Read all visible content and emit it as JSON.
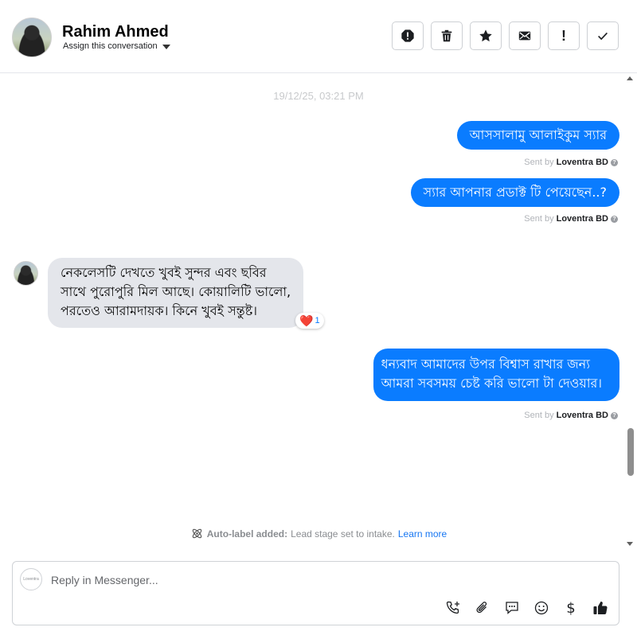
{
  "header": {
    "contact_name": "Rahim Ahmed",
    "assign_label": "Assign this conversation",
    "toolbar": [
      "spam-icon",
      "trash-icon",
      "star-icon",
      "envelope-icon",
      "exclamation-icon",
      "checkmark-icon"
    ],
    "toolbar_exclaim": "!"
  },
  "thread": {
    "timestamp": "19/12/25, 03:21 PM",
    "messages": [
      {
        "direction": "outgoing",
        "text": "আসসালামু আলাইকুম স্যার",
        "sent_prefix": "Sent by",
        "sent_by": "Loventra BD"
      },
      {
        "direction": "outgoing",
        "text": "স্যার আপনার প্রডাক্ট টি পেয়েছেন..?",
        "sent_prefix": "Sent by",
        "sent_by": "Loventra BD"
      },
      {
        "direction": "incoming",
        "lines": [
          "নেকলেসটি দেখতে খুবই সুন্দর এবং ছবির",
          "সাথে পুরোপুরি মিল আছে। কোয়ালিটি ভালো,",
          "পরতেও আরামদায়ক। কিনে খুবই সন্তুষ্ট।"
        ],
        "reaction": "❤️",
        "reaction_count": "1"
      },
      {
        "direction": "outgoing",
        "lines": [
          "ধন্যবাদ আমাদের উপর বিশ্বাস রাখার জন্য",
          "আমরা সবসময় চেষ্ট করি ভালো টা দেওয়ার।"
        ],
        "sent_prefix": "Sent by",
        "sent_by": "Loventra BD"
      }
    ],
    "auto_label": {
      "bold": "Auto-label added:",
      "text": "Lead stage set to intake.",
      "link": "Learn more"
    }
  },
  "composer": {
    "placeholder": "Reply in Messenger...",
    "avatar_text": "Loventra",
    "icons": [
      "call-add-icon",
      "attachment-icon",
      "saved-reply-icon",
      "emoji-icon",
      "dollar-icon",
      "thumbs-up-icon"
    ],
    "dollar_glyph": "$"
  },
  "colors": {
    "outgoing_bubble": "#0a7cff",
    "incoming_bubble": "#e4e6eb",
    "link": "#1877f2"
  }
}
